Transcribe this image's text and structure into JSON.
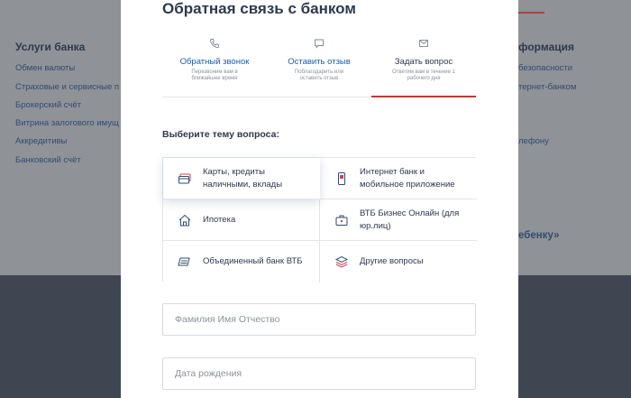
{
  "background": {
    "left_column": {
      "title": "Услуги банка",
      "links": [
        "Обмен валюты",
        "Страховые и сервисные п",
        "Брокерский счёт",
        "Витрина залогового имущ",
        "Аккредитивы",
        "Банковский счёт"
      ]
    },
    "right_column": {
      "title": "формация",
      "links": [
        "безопасности",
        "тернет-банком",
        "",
        "лефону"
      ],
      "promo": "ебенку»"
    }
  },
  "modal": {
    "title": "Обратная связь с банком",
    "tabs": [
      {
        "label": "Обратный звонок",
        "sub": "Перезвоним вам в ближайшее время",
        "icon": "phone-icon",
        "active": false
      },
      {
        "label": "Оставить отзыв",
        "sub": "Поблагодарить или оставить отзыв",
        "icon": "chat-icon",
        "active": false
      },
      {
        "label": "Задать вопрос",
        "sub": "Ответим вам в течение 1 рабочего дня",
        "icon": "mail-icon",
        "active": true
      }
    ],
    "question_label": "Выберите тему вопроса:",
    "topics": [
      {
        "label": "Карты, кредиты наличными, вклады",
        "icon": "cards-icon",
        "selected": true
      },
      {
        "label": "Интернет банк и мобильное приложение",
        "icon": "mobile-icon",
        "selected": false
      },
      {
        "label": "Ипотека",
        "icon": "house-icon",
        "selected": false
      },
      {
        "label": "ВТБ Бизнес Онлайн (для юр.лиц)",
        "icon": "briefcase-icon",
        "selected": false
      },
      {
        "label": "Объединенный банк ВТБ",
        "icon": "bank-icon",
        "selected": false
      },
      {
        "label": "Другие вопросы",
        "icon": "layers-icon",
        "selected": false
      }
    ],
    "fields": {
      "name_placeholder": "Фамилия Имя Отчество",
      "birth_placeholder": "Дата рождения"
    }
  },
  "colors": {
    "accent_red": "#d6302b",
    "link_blue": "#1f5ca8",
    "text_dark": "#2d3a4e",
    "overlay_bg": "#8f9297",
    "footer_bg": "#3f4652"
  }
}
